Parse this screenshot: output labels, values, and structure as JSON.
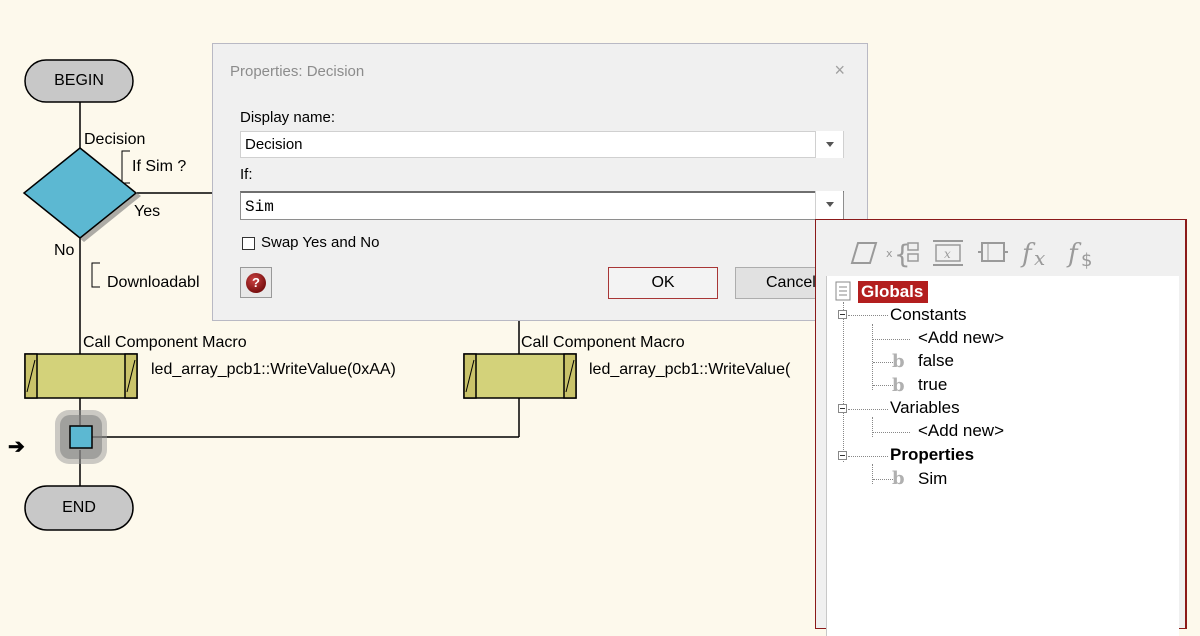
{
  "flowchart": {
    "begin_label": "BEGIN",
    "end_label": "END",
    "decision": {
      "title": "Decision",
      "condition": "If Sim ?",
      "yes_label": "Yes",
      "no_label": "No"
    },
    "comment_text": "Downloadabl",
    "macro_left": {
      "title": "Call Component Macro",
      "call": "led_array_pcb1::WriteValue(0xAA)"
    },
    "macro_right": {
      "title": "Call Component Macro",
      "call": "led_array_pcb1::WriteValue("
    },
    "side_arrow": "➔"
  },
  "dialog": {
    "title": "Properties: Decision",
    "close_glyph": "×",
    "display_name_label": "Display name:",
    "display_name_value": "Decision",
    "if_label": "If:",
    "if_value": "Sim",
    "swap_label": "Swap Yes and No",
    "swap_checked": false,
    "help_glyph": "?",
    "ok_label": "OK",
    "cancel_label": "Cancel"
  },
  "globals_panel": {
    "toolbar": [
      "parallelogram-icon",
      "variable-brace-icon",
      "expression-icon",
      "component-icon",
      "fx-icon",
      "fs-icon"
    ],
    "root_label": "Globals",
    "constants": {
      "label": "Constants",
      "items": [
        "<Add new>",
        "false",
        "true"
      ]
    },
    "variables": {
      "label": "Variables",
      "items": [
        "<Add new>"
      ]
    },
    "properties": {
      "label": "Properties",
      "items": [
        "Sim"
      ]
    },
    "accent_color": "#b31e1e"
  }
}
